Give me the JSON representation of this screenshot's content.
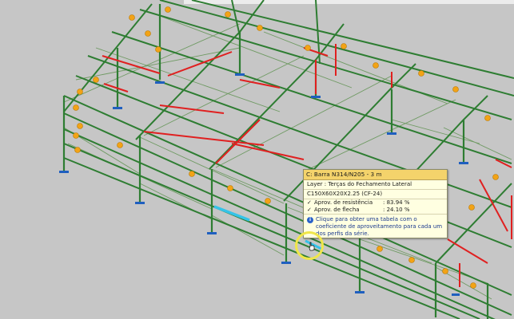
{
  "tooltip": {
    "title": "C: Barra N314/N205 - 3 m",
    "layer": "Layer : Terças do Fechamento Lateral",
    "profile": "C150X60X20X2.25 (CF-24)",
    "check1_label": "Aprov. de resistência",
    "check1_value": ": 83.94 %",
    "check2_label": "Aprov. de flecha",
    "check2_value": ": 24.10 %",
    "info_text": "Clique para obter uma tabela com o coeficiente de aproveitamento para cada um dos perfis da série."
  },
  "icons": {
    "check": "check-icon",
    "info": "info-icon",
    "cursor": "hand-cursor-icon",
    "support": "support-icon",
    "warning_badge": "warning-badge-icon"
  },
  "colors": {
    "background": "#c6c6c6",
    "structure_green": "#2e7d32",
    "bracing_green": "#6a9a5a",
    "failing_member_red": "#e02020",
    "selected_member_cyan": "#35c3e8",
    "support_blue": "#1f5fbf",
    "badge_orange": "#f2a316",
    "tooltip_header": "#f4d36b",
    "tooltip_bg": "#ffffe1"
  }
}
